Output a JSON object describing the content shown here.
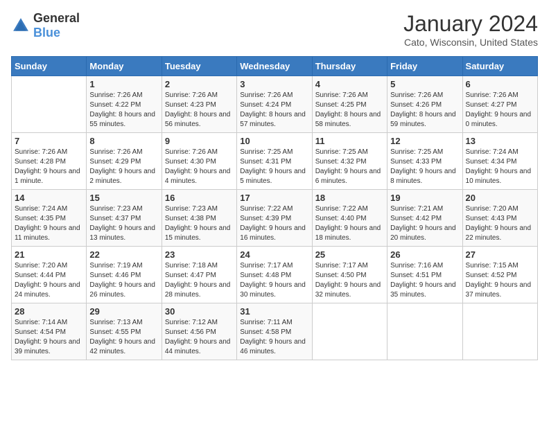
{
  "header": {
    "logo_general": "General",
    "logo_blue": "Blue",
    "title": "January 2024",
    "subtitle": "Cato, Wisconsin, United States"
  },
  "calendar": {
    "days_of_week": [
      "Sunday",
      "Monday",
      "Tuesday",
      "Wednesday",
      "Thursday",
      "Friday",
      "Saturday"
    ],
    "weeks": [
      [
        {
          "day": "",
          "sunrise": "",
          "sunset": "",
          "daylight": ""
        },
        {
          "day": "1",
          "sunrise": "Sunrise: 7:26 AM",
          "sunset": "Sunset: 4:22 PM",
          "daylight": "Daylight: 8 hours and 55 minutes."
        },
        {
          "day": "2",
          "sunrise": "Sunrise: 7:26 AM",
          "sunset": "Sunset: 4:23 PM",
          "daylight": "Daylight: 8 hours and 56 minutes."
        },
        {
          "day": "3",
          "sunrise": "Sunrise: 7:26 AM",
          "sunset": "Sunset: 4:24 PM",
          "daylight": "Daylight: 8 hours and 57 minutes."
        },
        {
          "day": "4",
          "sunrise": "Sunrise: 7:26 AM",
          "sunset": "Sunset: 4:25 PM",
          "daylight": "Daylight: 8 hours and 58 minutes."
        },
        {
          "day": "5",
          "sunrise": "Sunrise: 7:26 AM",
          "sunset": "Sunset: 4:26 PM",
          "daylight": "Daylight: 8 hours and 59 minutes."
        },
        {
          "day": "6",
          "sunrise": "Sunrise: 7:26 AM",
          "sunset": "Sunset: 4:27 PM",
          "daylight": "Daylight: 9 hours and 0 minutes."
        }
      ],
      [
        {
          "day": "7",
          "sunrise": "Sunrise: 7:26 AM",
          "sunset": "Sunset: 4:28 PM",
          "daylight": "Daylight: 9 hours and 1 minute."
        },
        {
          "day": "8",
          "sunrise": "Sunrise: 7:26 AM",
          "sunset": "Sunset: 4:29 PM",
          "daylight": "Daylight: 9 hours and 2 minutes."
        },
        {
          "day": "9",
          "sunrise": "Sunrise: 7:26 AM",
          "sunset": "Sunset: 4:30 PM",
          "daylight": "Daylight: 9 hours and 4 minutes."
        },
        {
          "day": "10",
          "sunrise": "Sunrise: 7:25 AM",
          "sunset": "Sunset: 4:31 PM",
          "daylight": "Daylight: 9 hours and 5 minutes."
        },
        {
          "day": "11",
          "sunrise": "Sunrise: 7:25 AM",
          "sunset": "Sunset: 4:32 PM",
          "daylight": "Daylight: 9 hours and 6 minutes."
        },
        {
          "day": "12",
          "sunrise": "Sunrise: 7:25 AM",
          "sunset": "Sunset: 4:33 PM",
          "daylight": "Daylight: 9 hours and 8 minutes."
        },
        {
          "day": "13",
          "sunrise": "Sunrise: 7:24 AM",
          "sunset": "Sunset: 4:34 PM",
          "daylight": "Daylight: 9 hours and 10 minutes."
        }
      ],
      [
        {
          "day": "14",
          "sunrise": "Sunrise: 7:24 AM",
          "sunset": "Sunset: 4:35 PM",
          "daylight": "Daylight: 9 hours and 11 minutes."
        },
        {
          "day": "15",
          "sunrise": "Sunrise: 7:23 AM",
          "sunset": "Sunset: 4:37 PM",
          "daylight": "Daylight: 9 hours and 13 minutes."
        },
        {
          "day": "16",
          "sunrise": "Sunrise: 7:23 AM",
          "sunset": "Sunset: 4:38 PM",
          "daylight": "Daylight: 9 hours and 15 minutes."
        },
        {
          "day": "17",
          "sunrise": "Sunrise: 7:22 AM",
          "sunset": "Sunset: 4:39 PM",
          "daylight": "Daylight: 9 hours and 16 minutes."
        },
        {
          "day": "18",
          "sunrise": "Sunrise: 7:22 AM",
          "sunset": "Sunset: 4:40 PM",
          "daylight": "Daylight: 9 hours and 18 minutes."
        },
        {
          "day": "19",
          "sunrise": "Sunrise: 7:21 AM",
          "sunset": "Sunset: 4:42 PM",
          "daylight": "Daylight: 9 hours and 20 minutes."
        },
        {
          "day": "20",
          "sunrise": "Sunrise: 7:20 AM",
          "sunset": "Sunset: 4:43 PM",
          "daylight": "Daylight: 9 hours and 22 minutes."
        }
      ],
      [
        {
          "day": "21",
          "sunrise": "Sunrise: 7:20 AM",
          "sunset": "Sunset: 4:44 PM",
          "daylight": "Daylight: 9 hours and 24 minutes."
        },
        {
          "day": "22",
          "sunrise": "Sunrise: 7:19 AM",
          "sunset": "Sunset: 4:46 PM",
          "daylight": "Daylight: 9 hours and 26 minutes."
        },
        {
          "day": "23",
          "sunrise": "Sunrise: 7:18 AM",
          "sunset": "Sunset: 4:47 PM",
          "daylight": "Daylight: 9 hours and 28 minutes."
        },
        {
          "day": "24",
          "sunrise": "Sunrise: 7:17 AM",
          "sunset": "Sunset: 4:48 PM",
          "daylight": "Daylight: 9 hours and 30 minutes."
        },
        {
          "day": "25",
          "sunrise": "Sunrise: 7:17 AM",
          "sunset": "Sunset: 4:50 PM",
          "daylight": "Daylight: 9 hours and 32 minutes."
        },
        {
          "day": "26",
          "sunrise": "Sunrise: 7:16 AM",
          "sunset": "Sunset: 4:51 PM",
          "daylight": "Daylight: 9 hours and 35 minutes."
        },
        {
          "day": "27",
          "sunrise": "Sunrise: 7:15 AM",
          "sunset": "Sunset: 4:52 PM",
          "daylight": "Daylight: 9 hours and 37 minutes."
        }
      ],
      [
        {
          "day": "28",
          "sunrise": "Sunrise: 7:14 AM",
          "sunset": "Sunset: 4:54 PM",
          "daylight": "Daylight: 9 hours and 39 minutes."
        },
        {
          "day": "29",
          "sunrise": "Sunrise: 7:13 AM",
          "sunset": "Sunset: 4:55 PM",
          "daylight": "Daylight: 9 hours and 42 minutes."
        },
        {
          "day": "30",
          "sunrise": "Sunrise: 7:12 AM",
          "sunset": "Sunset: 4:56 PM",
          "daylight": "Daylight: 9 hours and 44 minutes."
        },
        {
          "day": "31",
          "sunrise": "Sunrise: 7:11 AM",
          "sunset": "Sunset: 4:58 PM",
          "daylight": "Daylight: 9 hours and 46 minutes."
        },
        {
          "day": "",
          "sunrise": "",
          "sunset": "",
          "daylight": ""
        },
        {
          "day": "",
          "sunrise": "",
          "sunset": "",
          "daylight": ""
        },
        {
          "day": "",
          "sunrise": "",
          "sunset": "",
          "daylight": ""
        }
      ]
    ]
  }
}
